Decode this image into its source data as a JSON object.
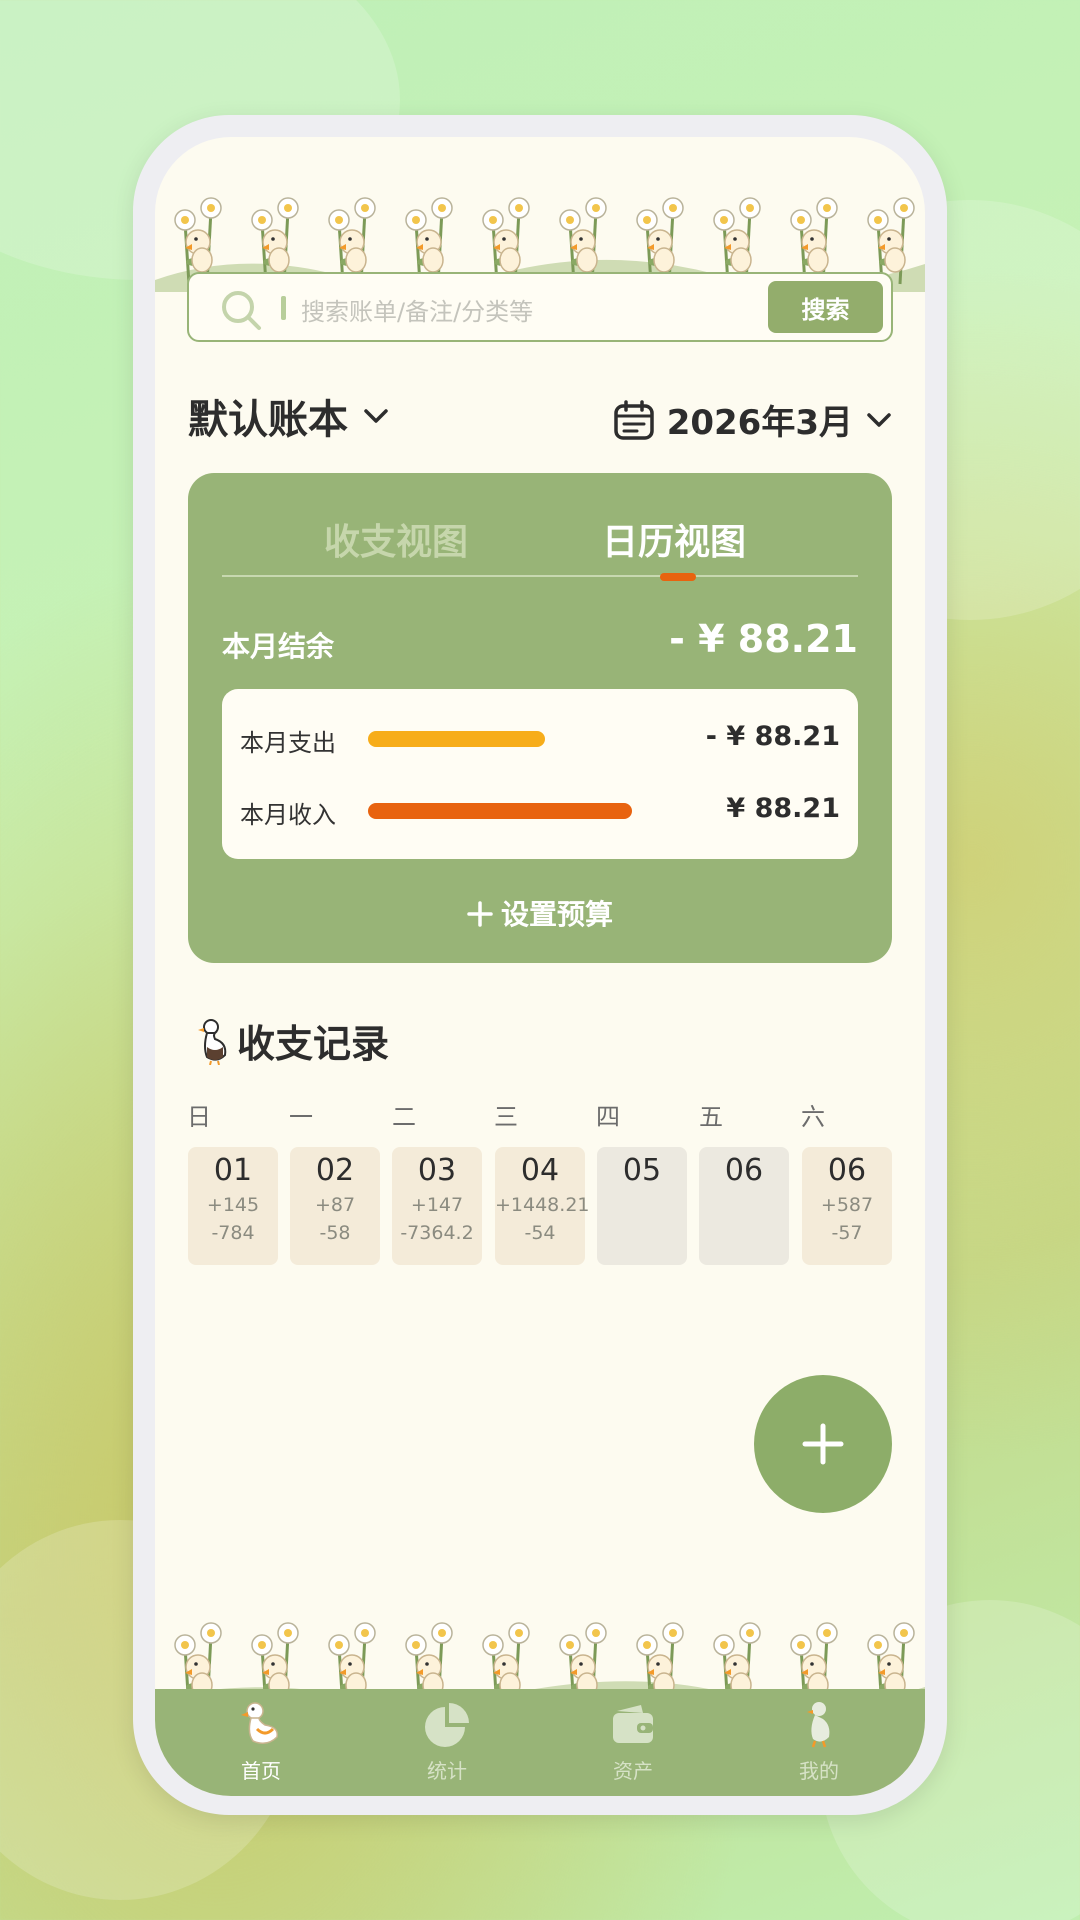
{
  "search": {
    "placeholder": "搜索账单/备注/分类等",
    "button_label": "搜索"
  },
  "header": {
    "book_name": "默认账本",
    "month": "2026年3月"
  },
  "summary": {
    "tabs": [
      {
        "label": "收支视图",
        "active": false
      },
      {
        "label": "日历视图",
        "active": true
      }
    ],
    "balance_label": "本月结余",
    "balance_value": "- ¥ 88.21",
    "expense": {
      "label": "本月支出",
      "value": "- ¥ 88.21",
      "bar_fraction": 0.38,
      "color": "#f7ad1a"
    },
    "income": {
      "label": "本月收入",
      "value": "¥ 88.21",
      "bar_fraction": 0.58,
      "color": "#e8630f"
    },
    "budget_label": "设置预算"
  },
  "records": {
    "title": "收支记录",
    "weekdays": [
      "日",
      "一",
      "二",
      "三",
      "四",
      "五",
      "六"
    ],
    "days": [
      {
        "day": "01",
        "income": "+145",
        "expense": "-784"
      },
      {
        "day": "02",
        "income": "+87",
        "expense": "-58"
      },
      {
        "day": "03",
        "income": "+147",
        "expense": "-7364.2"
      },
      {
        "day": "04",
        "income": "+1448.21",
        "expense": "-54"
      },
      {
        "day": "05",
        "income": "",
        "expense": ""
      },
      {
        "day": "06",
        "income": "",
        "expense": ""
      },
      {
        "day": "06",
        "income": "+587",
        "expense": "-57"
      }
    ]
  },
  "tabbar": [
    {
      "label": "首页",
      "icon": "goose-home-icon",
      "active": true
    },
    {
      "label": "统计",
      "icon": "pie-chart-icon",
      "active": false
    },
    {
      "label": "资产",
      "icon": "wallet-icon",
      "active": false
    },
    {
      "label": "我的",
      "icon": "goose-profile-icon",
      "active": false
    }
  ],
  "colors": {
    "primary": "#98b477",
    "accent": "#e8630f",
    "background": "#fdfbf0"
  }
}
